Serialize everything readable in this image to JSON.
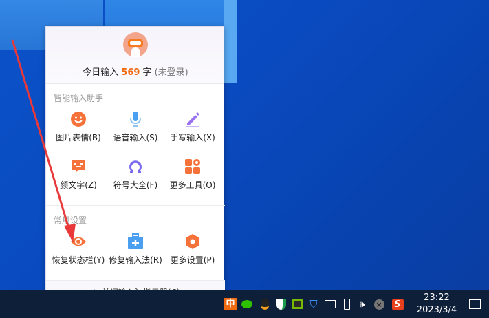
{
  "popup": {
    "header": {
      "prefix": "今日输入",
      "count": "569",
      "unit": "字",
      "status": "(未登录)"
    },
    "section1": {
      "title": "智能输入助手",
      "items": [
        {
          "label": "图片表情(B)",
          "icon": "smiley-icon",
          "color": "#f5733a"
        },
        {
          "label": "语音输入(S)",
          "icon": "microphone-icon",
          "color": "#4a9ff0"
        },
        {
          "label": "手写输入(X)",
          "icon": "pen-icon",
          "color": "#9b72f0"
        },
        {
          "label": "颜文字(Z)",
          "icon": "kaomoji-icon",
          "color": "#f5733a"
        },
        {
          "label": "符号大全(F)",
          "icon": "omega-icon",
          "color": "#7a6af0"
        },
        {
          "label": "更多工具(O)",
          "icon": "grid-icon",
          "color": "#f5733a"
        }
      ]
    },
    "section2": {
      "title": "常用设置",
      "items": [
        {
          "label": "恢复状态栏(Y)",
          "icon": "eye-icon",
          "color": "#f5733a"
        },
        {
          "label": "修复输入法(R)",
          "icon": "toolbox-icon",
          "color": "#4a9ff0"
        },
        {
          "label": "更多设置(P)",
          "icon": "hexagon-settings-icon",
          "color": "#f5733a"
        }
      ]
    },
    "footer": {
      "label": "关闭输入法指示器(C)",
      "icon": "power-icon"
    }
  },
  "taskbar": {
    "ime": "中",
    "time": "23:22",
    "date": "2023/3/4"
  }
}
